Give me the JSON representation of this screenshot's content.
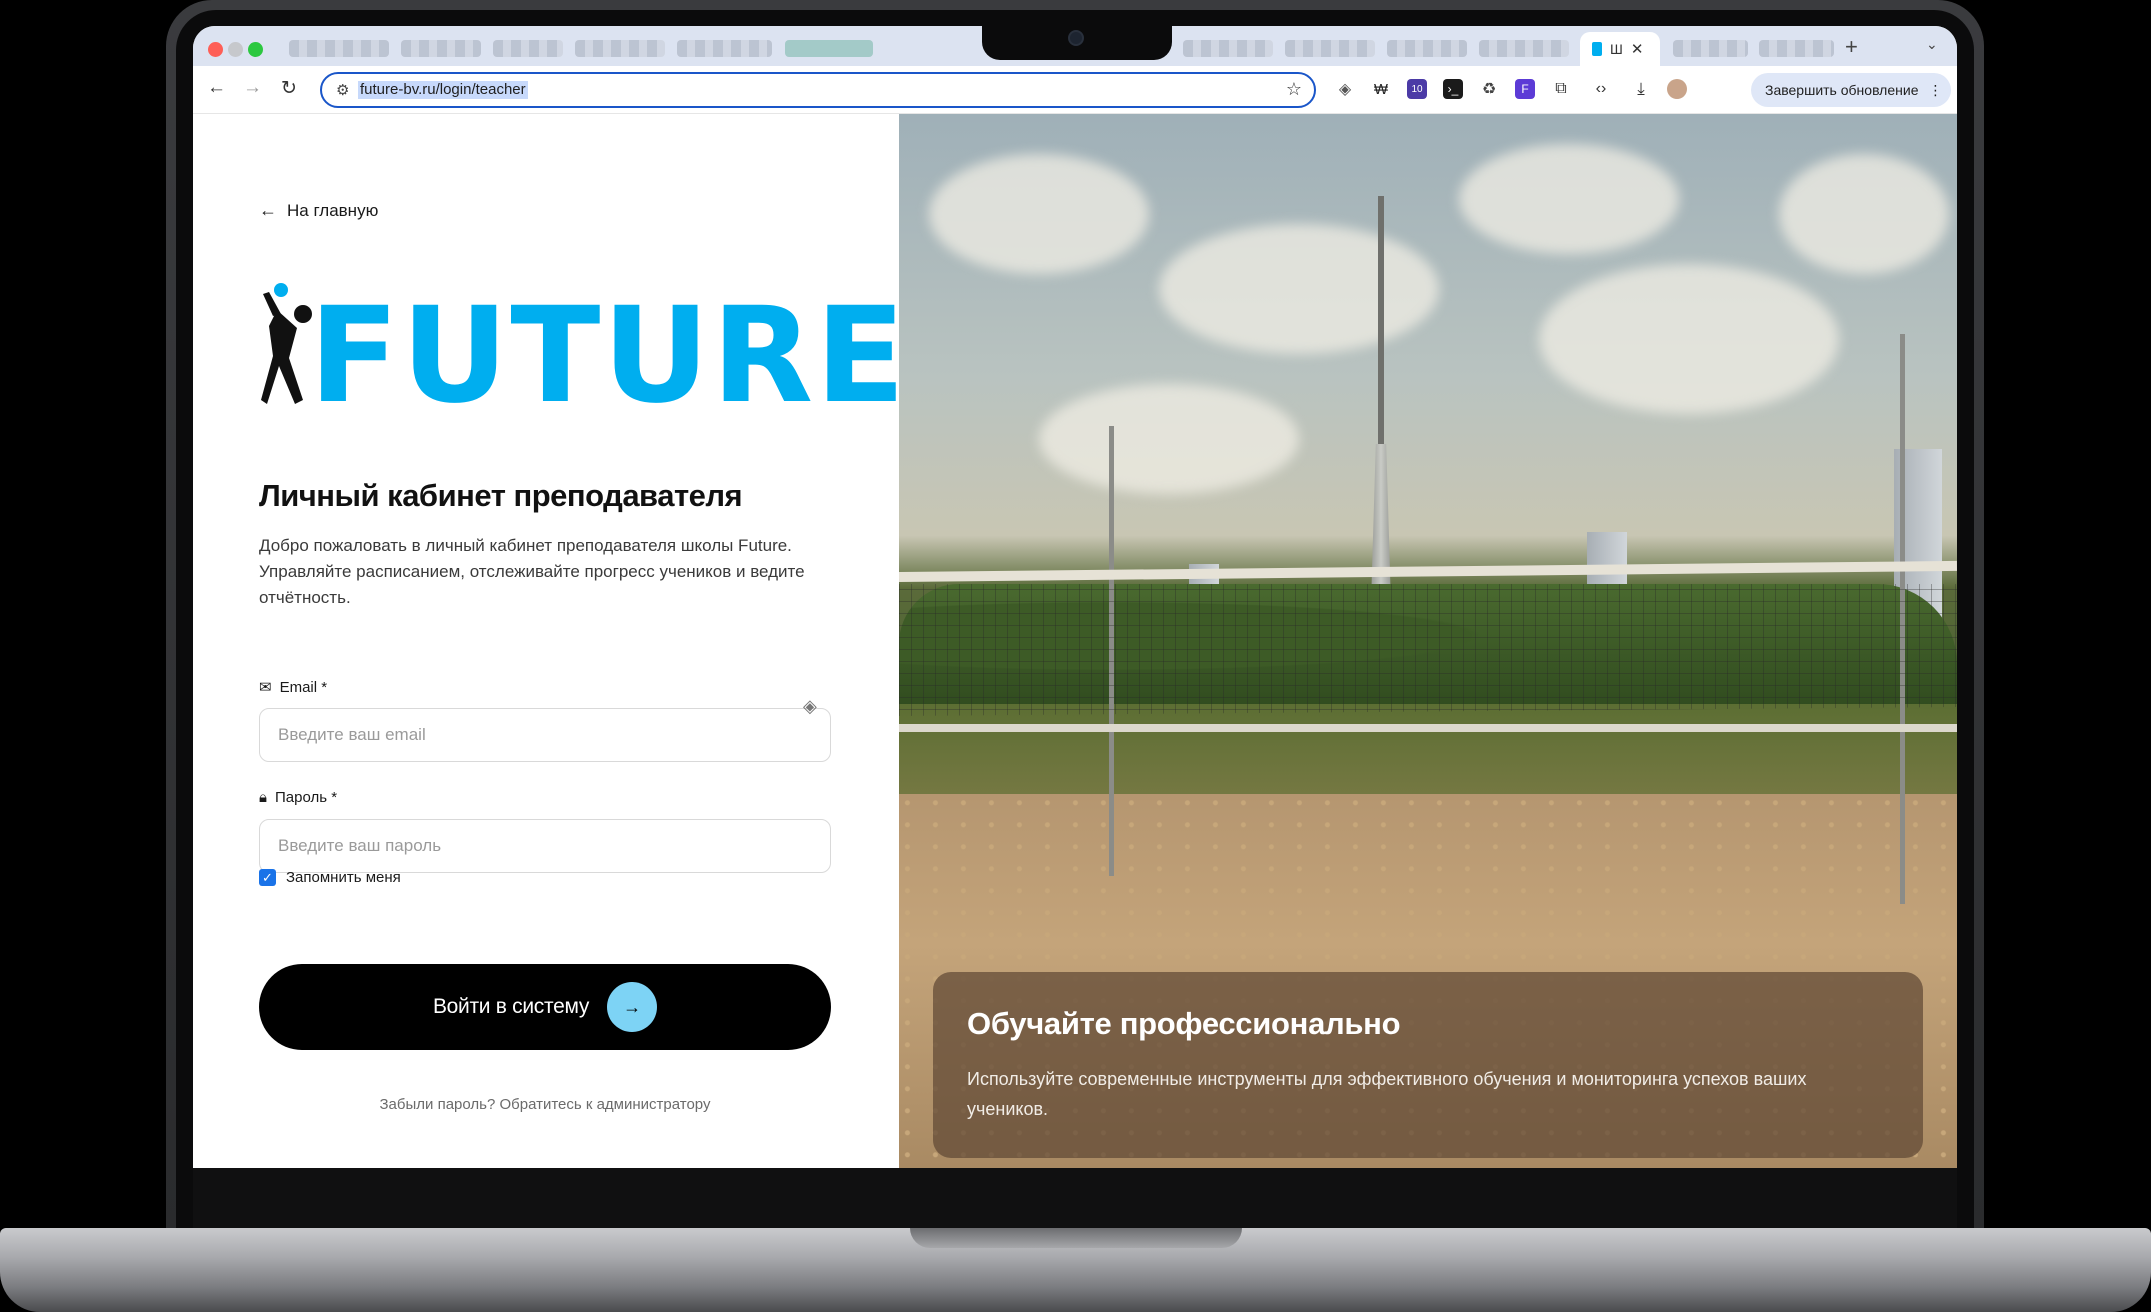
{
  "browser": {
    "active_tab_title": "Ш",
    "url": "future-bv.ru/login/teacher",
    "update_button": "Завершить обновление",
    "extension_badge": "10"
  },
  "page": {
    "back_link": "На главную",
    "logo_text": "FUTURE",
    "title": "Личный кабинет преподавателя",
    "subtitle": "Добро пожаловать в личный кабинет преподавателя школы Future. Управляйте расписанием, отслеживайте прогресс учеников и ведите отчётность.",
    "email": {
      "label": "Email *",
      "placeholder": "Введите ваш email",
      "value": ""
    },
    "password": {
      "label": "Пароль *",
      "placeholder": "Введите ваш пароль",
      "value": ""
    },
    "remember_me": {
      "label": "Запомнить меня",
      "checked": true
    },
    "login_button": "Войти в систему",
    "forgot": "Забыли пароль? Обратитесь к администратору"
  },
  "promo": {
    "title": "Обучайте профессионально",
    "text": "Используйте современные инструменты для эффективного обучения и мониторинга успехов ваших учеников."
  },
  "colors": {
    "brand": "#00aeef",
    "button": "#000000",
    "button_arrow": "#7dd3f5",
    "focus": "#1a56c9",
    "checkbox": "#1a73e8"
  }
}
